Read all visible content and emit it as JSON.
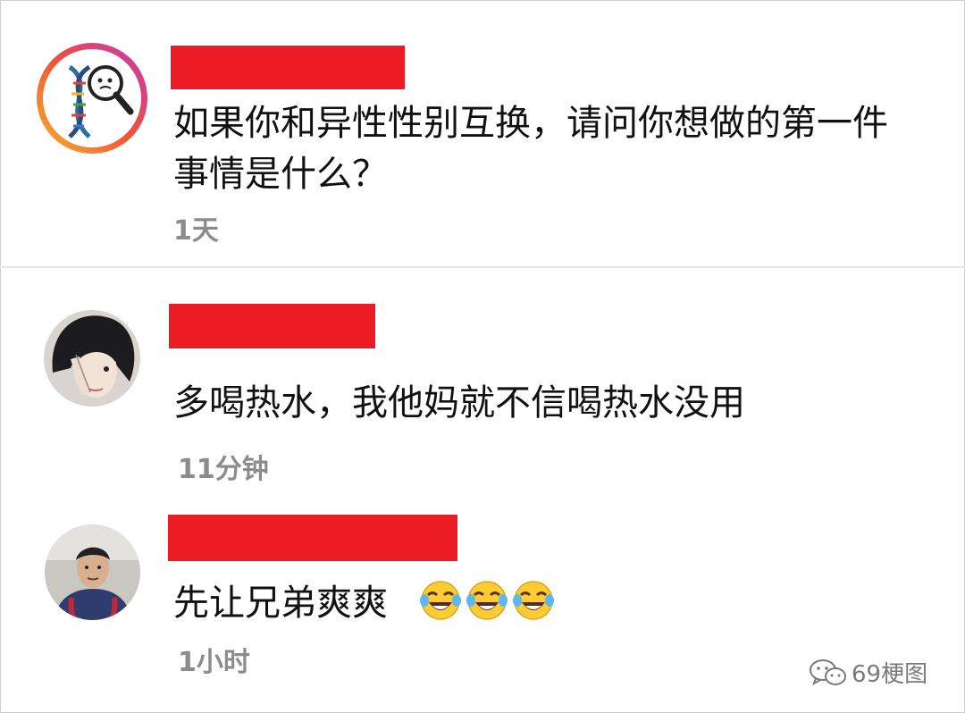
{
  "post": {
    "text": "如果你和异性性别互换，请问你想做的第一件事情是什么？",
    "time": "1天",
    "avatar_icon": "dna-magnifier-meme-avatar-icon"
  },
  "comments": [
    {
      "text": "多喝热水，我他妈就不信喝热水没用",
      "time": "11分钟",
      "avatar_icon": "anime-boy-avatar-icon"
    },
    {
      "text": "先让兄弟爽爽",
      "time": "1小时",
      "avatar_icon": "selfie-boy-avatar-icon",
      "emojis": [
        "tears-of-joy-emoji",
        "tears-of-joy-emoji",
        "tears-of-joy-emoji"
      ]
    }
  ],
  "watermark": {
    "text": "69梗图",
    "icon": "wechat-icon"
  },
  "colors": {
    "redaction": "#ec1c24",
    "time_text": "#8c8c8c"
  }
}
